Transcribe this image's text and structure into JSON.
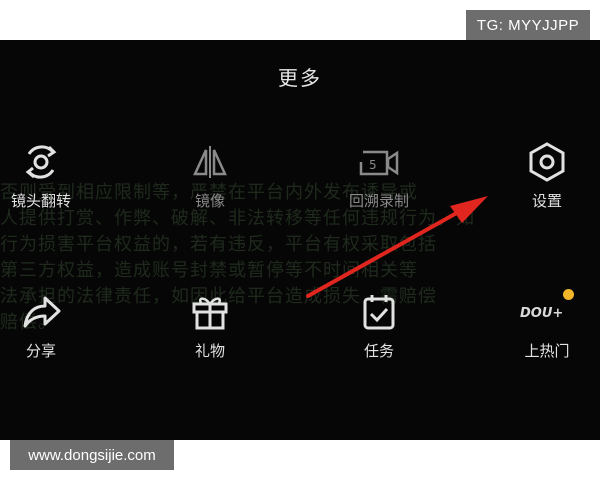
{
  "badge": "TG: MYYJJPP",
  "panel": {
    "title": "更多",
    "background_text": [
      "否则受到相应限制等，严禁在平台内外发布诱导或",
      "人提供打赏、作弊、破解、非法转移等任何违规行为，如",
      "行为损害平台权益的，若有违反，平台有权采取包括",
      "第三方权益，造成账号封禁或暂停等不时间相关等",
      "法承担的法律责任，如因此给平台造成损失，需赔偿",
      "赔偿。"
    ],
    "items": [
      {
        "label": "镜头翻转",
        "icon": "camera-flip-icon"
      },
      {
        "label": "镜像",
        "icon": "mirror-icon"
      },
      {
        "label": "回溯录制",
        "icon": "replay-record-icon"
      },
      {
        "label": "设置",
        "icon": "settings-icon"
      },
      {
        "label": "分享",
        "icon": "share-icon"
      },
      {
        "label": "礼物",
        "icon": "gift-icon"
      },
      {
        "label": "任务",
        "icon": "task-icon"
      },
      {
        "label": "上热门",
        "icon": "dou-plus-icon",
        "icon_text": "DOU+"
      }
    ]
  },
  "watermark": "www.dongsijie.com",
  "colors": {
    "panel_bg": "#060606",
    "arrow": "#e0261f",
    "badge_bg": "#6d6d6d",
    "dot": "#f3b62b"
  }
}
